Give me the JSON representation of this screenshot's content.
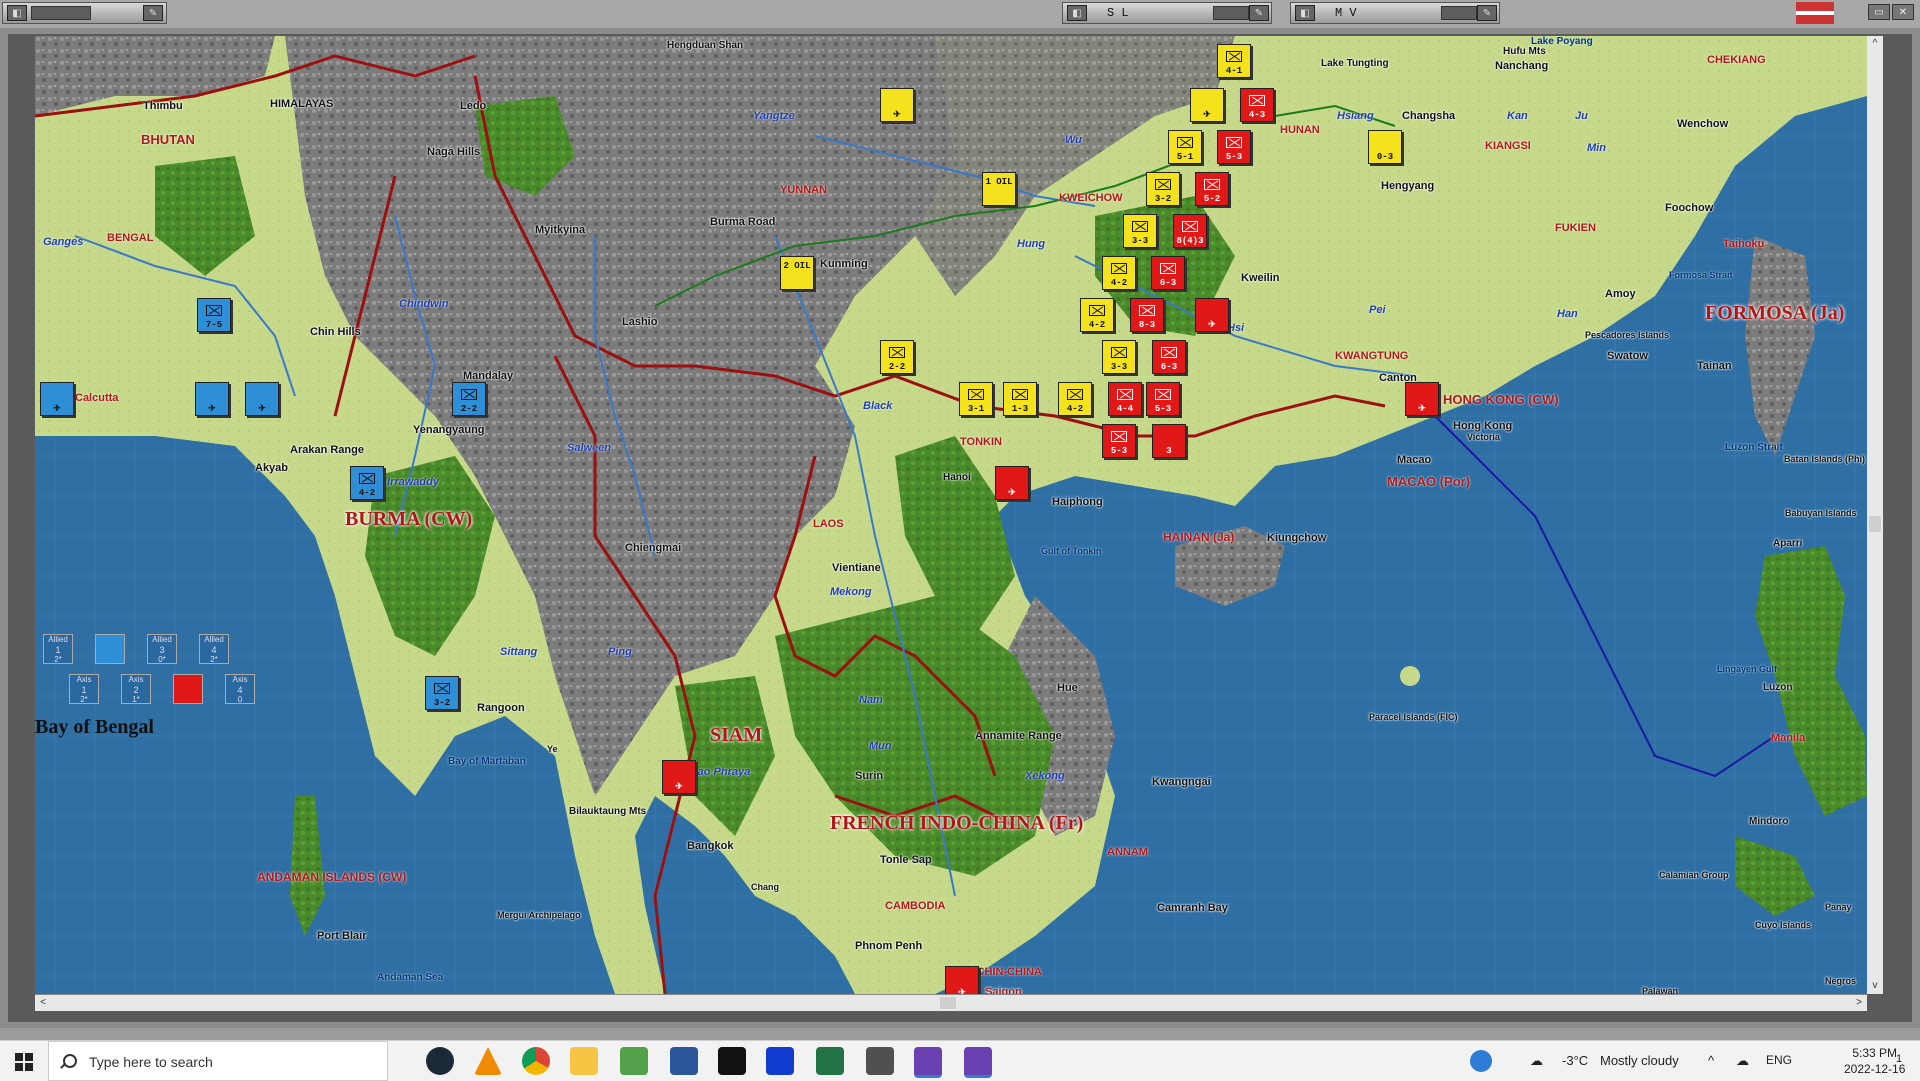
{
  "windows": {
    "title_sl": "S L",
    "title_mv": "M V"
  },
  "map": {
    "country_labels": [
      "BURMA (CW)",
      "SIAM",
      "FRENCH INDO-CHINA (Fr)",
      "FORMOSA (Ja)",
      "HONG KONG (CW)",
      "MACAO (Por)",
      "HAINAN (Ja)",
      "ANDAMAN ISLANDS (CW)",
      "BHUTAN"
    ],
    "region_labels": [
      "HIMALAYAS",
      "BENGAL",
      "YUNNAN",
      "KWEICHOW",
      "HUNAN",
      "KIANGSI",
      "CHEKIANG",
      "FUKIEN",
      "KWANGTUNG",
      "TONKIN",
      "LAOS",
      "ANNAM",
      "CAMBODIA",
      "COCHIN-CHINA"
    ],
    "cities": [
      "Thimbu",
      "Ledo",
      "Naga Hills",
      "Myitkyina",
      "Burma Road",
      "Kunming",
      "Chin Hills",
      "Lashio",
      "Mandalay",
      "Yenangyaung",
      "Arakan Range",
      "Akyab",
      "Irrawaddy",
      "Chiengmai",
      "Vientiane",
      "Hanoi",
      "Haiphong",
      "Hue",
      "Annamite Range",
      "Kwangngai",
      "Camranh Bay",
      "Phnom Penh",
      "Saigon",
      "Bangkok",
      "Surin",
      "Chang",
      "Tonle Sap",
      "Bilauktaung Mts",
      "Rangoon",
      "Ye",
      "Mergui Archipelago",
      "Port Blair",
      "Andaman Sea",
      "Bay of Martaban",
      "Hengduan Shan",
      "Nanchang",
      "Changsha",
      "Hengyang",
      "Kweilin",
      "Canton",
      "Macao",
      "Hong Kong",
      "Victoria",
      "Kiungchow",
      "Swatow",
      "Amoy",
      "Foochow",
      "Wenchow",
      "Taihoku",
      "Tainan",
      "Lake Tungting",
      "Hufu Mts",
      "Lake Poyang",
      "Pescadores Islands",
      "Formosa Strait",
      "Luzon Strait",
      "Batan Islands (Phi)",
      "Babuyan Islands",
      "Aparri",
      "Lingayen Gulf",
      "Luzon",
      "Manila",
      "Mindoro",
      "Calamian Group",
      "Cuyo Islands",
      "Panay",
      "Palawan",
      "Negros",
      "Paracel Islands (FIC)",
      "Gulf of Tonkin",
      "Calcutta"
    ],
    "rivers": [
      "Ganges",
      "Chindwin",
      "Salween",
      "Sittang",
      "Ping",
      "Mekong",
      "Nam",
      "Mun",
      "Chao Phraya",
      "Xekong",
      "Black",
      "Hung",
      "Hsi",
      "Pei",
      "Yangtze",
      "Wu",
      "Hsiang",
      "Kan",
      "Ju",
      "Min",
      "Han"
    ],
    "sea_label": "Bay of Bengal"
  },
  "units": {
    "yellow": [
      "4-1",
      "5-1",
      "3-2",
      "3-3",
      "4-2",
      "4-2",
      "3-3",
      "2-2",
      "3-1",
      "1-3",
      "4-2",
      "0-3",
      "1 OIL",
      "2 OIL"
    ],
    "red": [
      "4-3",
      "5-3",
      "5-2",
      "5-3",
      "8(4)3",
      "6-3",
      "8-3",
      "6-3",
      "4-4",
      "5-3",
      "3"
    ],
    "blue": [
      "7-5",
      "2-2",
      "4-2",
      "3-2"
    ]
  },
  "turn_track": {
    "allied": [
      {
        "label": "Allied",
        "num": "1",
        "sub": "2*"
      },
      {
        "label": "",
        "num": "",
        "sub": ""
      },
      {
        "label": "Allied",
        "num": "3",
        "sub": "0*"
      },
      {
        "label": "Allied",
        "num": "4",
        "sub": "2*"
      }
    ],
    "axis": [
      {
        "label": "Axis",
        "num": "1",
        "sub": "2*"
      },
      {
        "label": "Axis",
        "num": "2",
        "sub": "1*"
      },
      {
        "label": "",
        "num": "",
        "sub": ""
      },
      {
        "label": "Axis",
        "num": "4",
        "sub": "0"
      }
    ]
  },
  "taskbar": {
    "search_placeholder": "Type here to search",
    "weather_temp": "-3°C",
    "weather_text": "Mostly cloudy",
    "lang": "ENG",
    "time": "5:33 PM",
    "date": "2022-12-16",
    "notif_count": "1"
  }
}
